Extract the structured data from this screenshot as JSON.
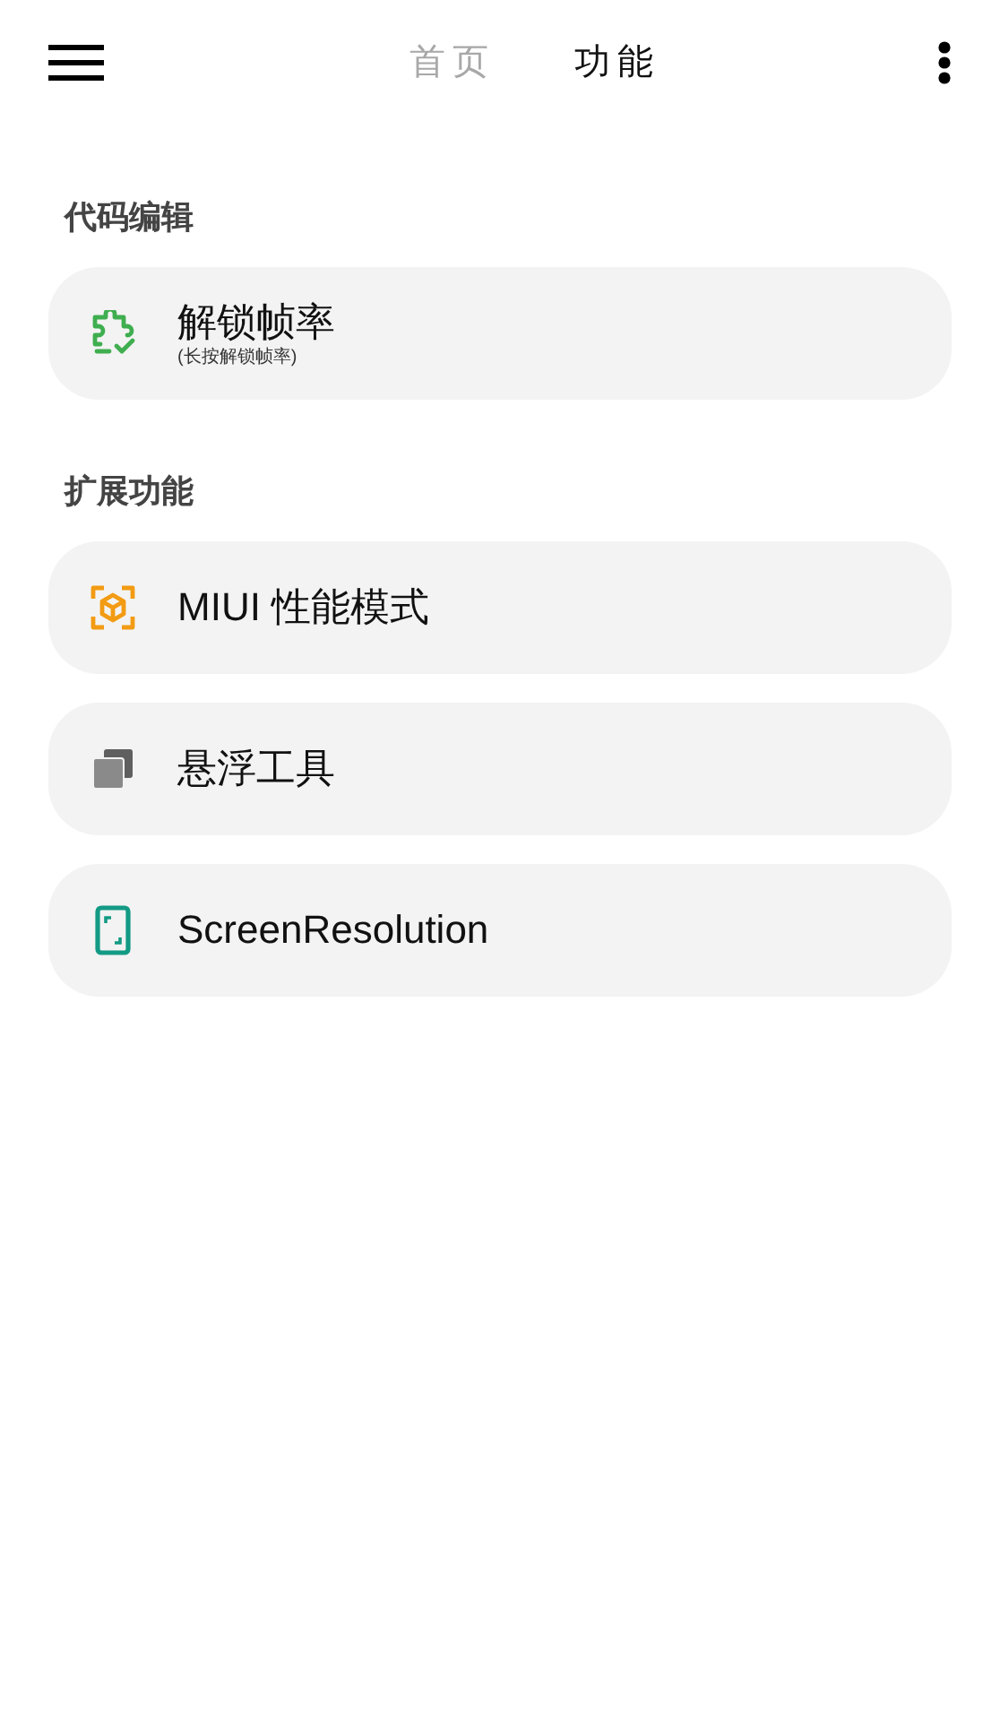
{
  "tabs": [
    {
      "label": "首页",
      "selected": false
    },
    {
      "label": "功能",
      "selected": true
    }
  ],
  "sections": [
    {
      "title": "代码编辑",
      "items": [
        {
          "label": "解锁帧率",
          "subtitle": "(长按解锁帧率)"
        }
      ]
    },
    {
      "title": "扩展功能",
      "items": [
        {
          "label": "MIUI 性能模式"
        },
        {
          "label": "悬浮工具"
        },
        {
          "label": "ScreenResolution"
        }
      ]
    }
  ]
}
